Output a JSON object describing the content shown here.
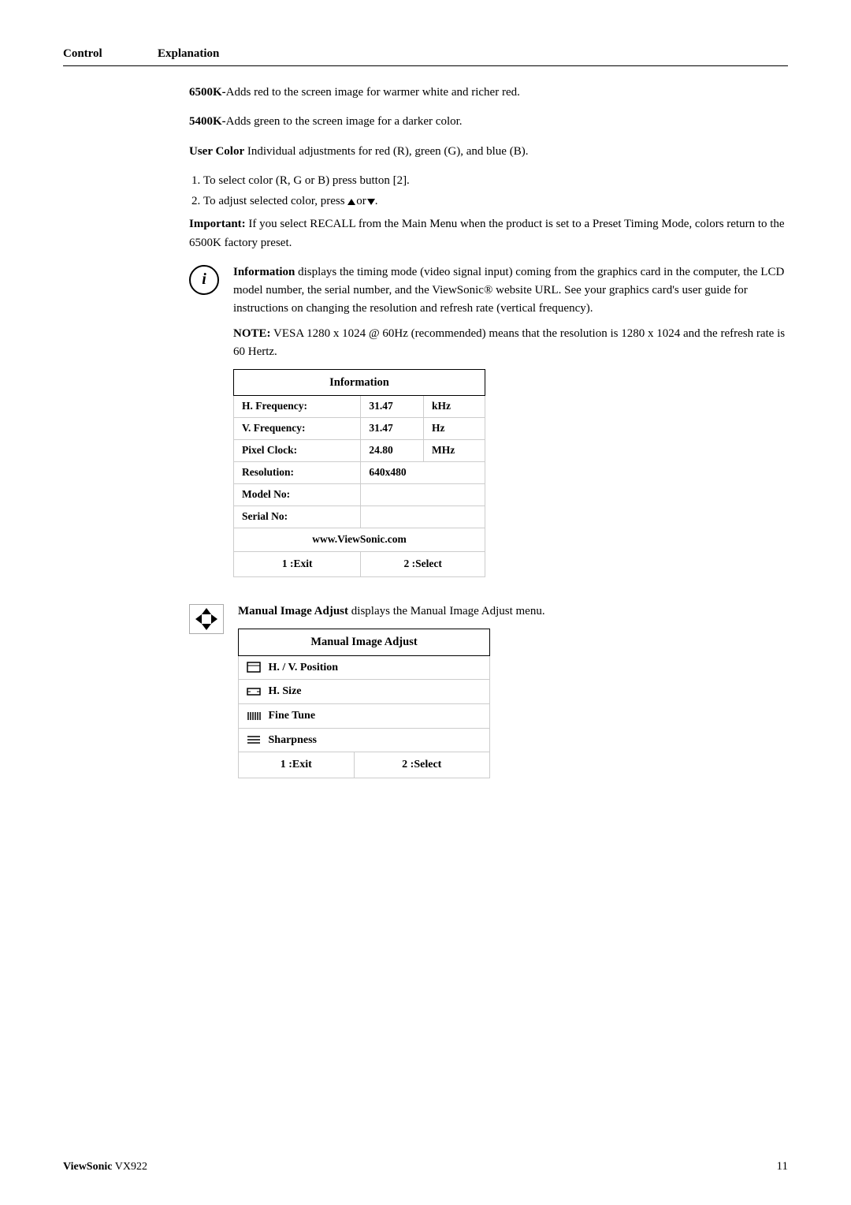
{
  "header": {
    "control_label": "Control",
    "explanation_label": "Explanation"
  },
  "sections": {
    "color_6500k": {
      "bold": "6500K-",
      "text": "Adds red to the screen image for warmer white and richer red."
    },
    "color_5400k": {
      "bold": "5400K-",
      "text": "Adds green to the screen image for a darker color."
    },
    "user_color": {
      "bold": "User Color",
      "text": "  Individual adjustments for red (R), green (G),  and blue (B)."
    },
    "step1": "To select color (R, G or B) press button [2].",
    "step2": "To adjust selected color, press",
    "step2_end": "or",
    "important_bold": "Important:",
    "important_text": " If you select RECALL from the Main Menu when the product is set to a Preset Timing Mode, colors return to the 6500K factory preset.",
    "information_bold": "Information",
    "information_text": " displays the timing mode (video signal input) coming from the graphics card in the computer, the LCD model number, the serial number, and the ViewSonic® website URL. See your graphics card's user guide for instructions on changing the resolution and refresh rate (vertical frequency).",
    "note_bold": "NOTE:",
    "note_text": " VESA 1280 x 1024 @ 60Hz (recommended) means that the resolution is 1280 x 1024 and the refresh rate is 60 Hertz.",
    "manual_image_adjust_bold": "Manual Image Adjust",
    "manual_image_adjust_text": " displays the Manual Image Adjust menu."
  },
  "info_table": {
    "title": "Information",
    "rows": [
      {
        "label": "H. Frequency:",
        "value": "31.47",
        "unit": "kHz"
      },
      {
        "label": "V. Frequency:",
        "value": "31.47",
        "unit": "Hz"
      },
      {
        "label": "Pixel Clock:",
        "value": "24.80",
        "unit": "MHz"
      },
      {
        "label": "Resolution:",
        "value": "640x480",
        "unit": ""
      },
      {
        "label": "Model No:",
        "value": "",
        "unit": ""
      },
      {
        "label": "Serial No:",
        "value": "",
        "unit": ""
      }
    ],
    "url": "www.ViewSonic.com",
    "exit_label": "1 :Exit",
    "select_label": "2 :Select"
  },
  "manual_table": {
    "title": "Manual Image Adjust",
    "items": [
      {
        "icon": "hv-position",
        "label": "H. / V. Position"
      },
      {
        "icon": "h-size",
        "label": "H. Size"
      },
      {
        "icon": "fine-tune",
        "label": "Fine Tune"
      },
      {
        "icon": "sharpness",
        "label": "Sharpness"
      }
    ],
    "exit_label": "1 :Exit",
    "select_label": "2 :Select"
  },
  "footer": {
    "brand": "ViewSonic",
    "model": "VX922",
    "page": "11"
  }
}
